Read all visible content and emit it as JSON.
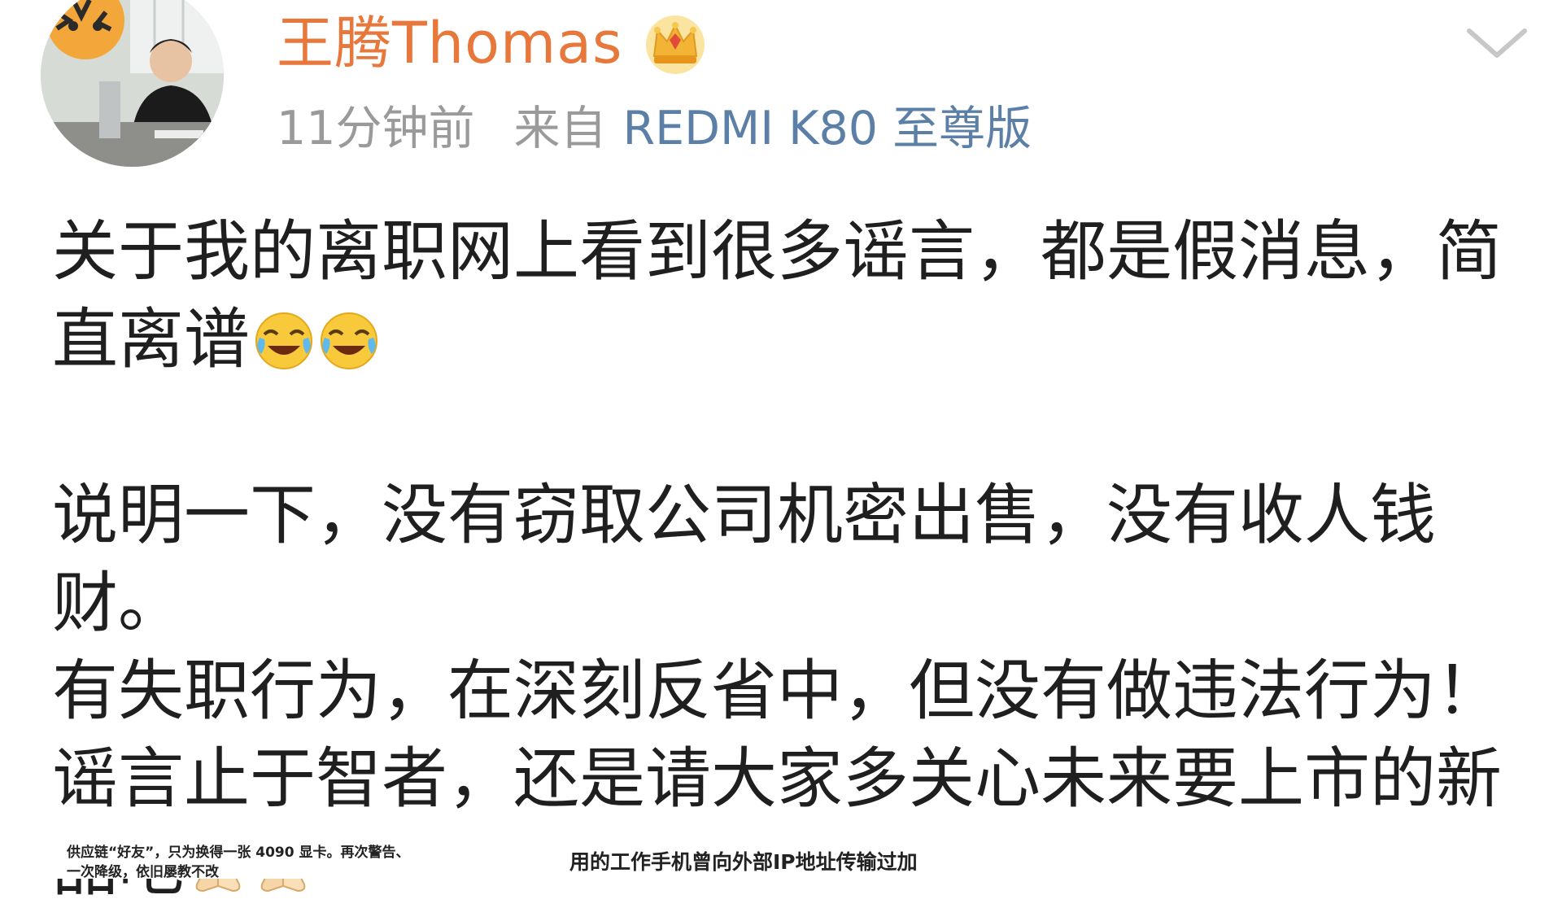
{
  "post": {
    "author": {
      "name": "王腾Thomas",
      "badge_icon": "crown-icon",
      "name_color": "#e8773b"
    },
    "meta": {
      "time": "11分钟前",
      "from_label": "来自",
      "device": "REDMI K80 至尊版",
      "device_color": "#5b7fa6"
    },
    "menu_icon": "chevron-down-icon",
    "text": {
      "para1": "关于我的离职网上看到很多谣言，都是假消息，简直离谱",
      "para1_emojis": [
        "laugh-cry-emoji",
        "laugh-cry-emoji"
      ],
      "para2_line1": "说明一下，没有窃取公司机密出售，没有收人钱财。",
      "para2_line2": "有失职行为，在深刻反省中，但没有做违法行为！",
      "para2_line3": "谣言止于智者，还是请大家多关心未来要上市的新品吧",
      "para2_emojis": [
        "pray-hands-emoji",
        "pray-hands-emoji"
      ]
    }
  },
  "attached_image": {
    "left_text_line1": "供应链“好友”，只为换得一张 4090 显卡。再次警告、",
    "left_text_line2": "一次降级，依旧屡教不改",
    "right_text": "用的工作手机曾向外部IP地址传输过加"
  }
}
